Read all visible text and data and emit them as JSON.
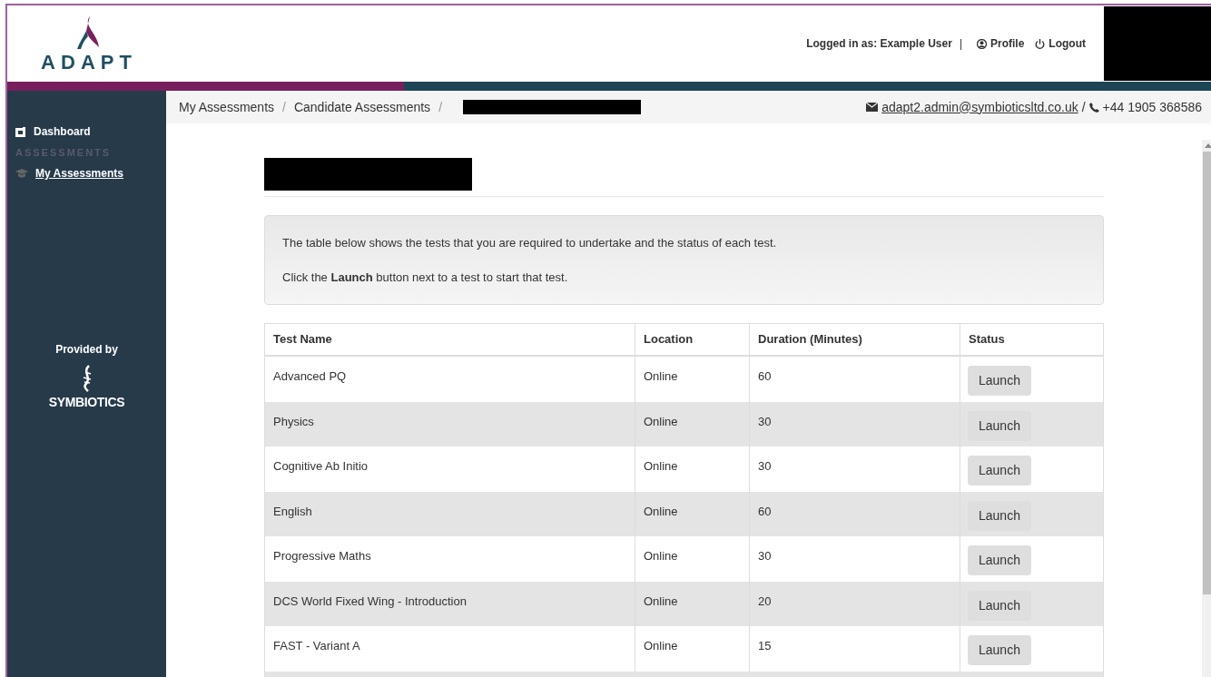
{
  "header": {
    "logo_text": "ADAPT",
    "user_text": "Logged in as: Example User",
    "separator": "|",
    "links": [
      {
        "kind": "profile",
        "label": "Profile"
      },
      {
        "kind": "logout",
        "label": "Logout"
      }
    ]
  },
  "sidebar": {
    "items": [
      {
        "kind": "link",
        "label": "Dashboard",
        "selected": false
      },
      {
        "kind": "heading",
        "label": "ASSESSMENTS"
      },
      {
        "kind": "link",
        "label": "My Assessments",
        "selected": true
      }
    ],
    "provided_by": "Provided by",
    "provider_logo_text": "SYMBIOTICS"
  },
  "breadcrumbs": [
    {
      "label": "My Assessments",
      "separator": "/"
    },
    {
      "label": "Candidate Assessments",
      "separator": "/"
    }
  ],
  "contact": {
    "email": "adapt2.admin@symbioticsltd.co.uk",
    "separator": "/",
    "phone": "+44 1905 368586"
  },
  "info": [
    "The table below shows the tests that you are required to undertake and the status of each test.",
    "Click the **Launch** button next to a test to start that test."
  ],
  "table": {
    "columns": [
      "Test Name",
      "Location",
      "Duration (Minutes)",
      "Status"
    ],
    "rows": [
      {
        "name": "Advanced PQ",
        "location": "Online",
        "duration": "60",
        "action": "Launch"
      },
      {
        "name": "Physics",
        "location": "Online",
        "duration": "30",
        "action": "Launch"
      },
      {
        "name": "Cognitive Ab Initio",
        "location": "Online",
        "duration": "30",
        "action": "Launch"
      },
      {
        "name": "English",
        "location": "Online",
        "duration": "60",
        "action": "Launch"
      },
      {
        "name": "Progressive Maths",
        "location": "Online",
        "duration": "30",
        "action": "Launch"
      },
      {
        "name": "DCS World Fixed Wing - Introduction",
        "location": "Online",
        "duration": "20",
        "action": "Launch"
      },
      {
        "name": "FAST - Variant A",
        "location": "Online",
        "duration": "15",
        "action": "Launch"
      }
    ]
  }
}
